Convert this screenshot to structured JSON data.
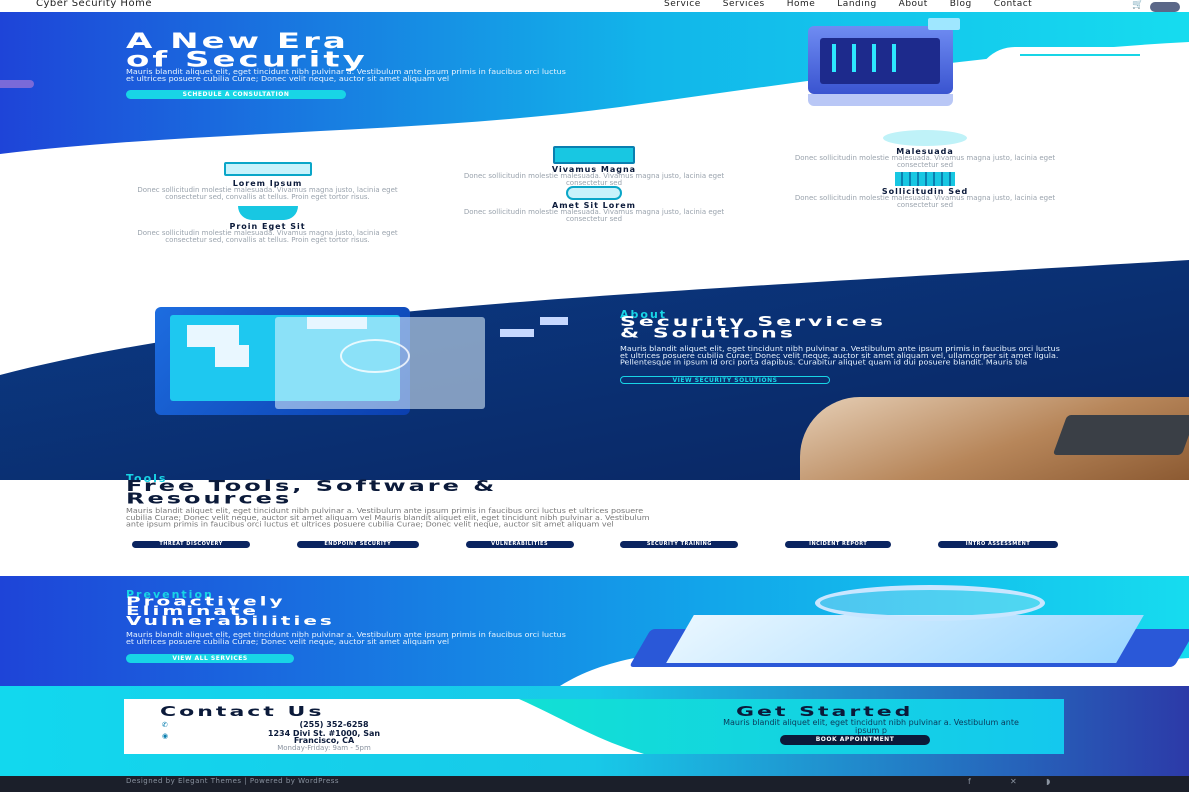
{
  "header": {
    "site_title": "Cyber Security Home",
    "nav": [
      "Service",
      "Services",
      "Home",
      "Landing",
      "About",
      "Blog",
      "Contact"
    ]
  },
  "hero": {
    "title_line1": "A New Era",
    "title_line2": "of Security",
    "body": "Mauris blandit aliquet elit, eget tincidunt nibh pulvinar a. Vestibulum ante ipsum primis in faucibus orci luctus et ultrices posuere cubilia Curae; Donec velit neque, auctor sit amet aliquam vel",
    "cta": "SCHEDULE A CONSULTATION"
  },
  "services": [
    {
      "title": "Lorem Ipsum",
      "body": "Donec sollicitudin molestie malesuada. Vivamus magna justo, lacinia eget consectetur sed, convallis at tellus. Proin eget tortor risus."
    },
    {
      "title": "Proin Eget Sit",
      "body": "Donec sollicitudin molestie malesuada. Vivamus magna justo, lacinia eget consectetur sed, convallis at tellus. Proin eget tortor risus."
    },
    {
      "title": "Vivamus Magna",
      "body": "Donec sollicitudin molestie malesuada. Vivamus magna justo, lacinia eget consectetur sed"
    },
    {
      "title": "Amet Sit Lorem",
      "body": "Donec sollicitudin molestie malesuada. Vivamus magna justo, lacinia eget consectetur sed"
    },
    {
      "title": "Malesuada",
      "body": "Donec sollicitudin molestie malesuada. Vivamus magna justo, lacinia eget consectetur sed"
    },
    {
      "title": "Sollicitudin Sed",
      "body": "Donec sollicitudin molestie malesuada. Vivamus magna justo, lacinia eget consectetur sed"
    }
  ],
  "about": {
    "eyebrow": "About",
    "title_line1": "Security Services",
    "title_line2": "& Solutions",
    "body": "Mauris blandit aliquet elit, eget tincidunt nibh pulvinar a. Vestibulum ante ipsum primis in faucibus orci luctus et ultrices posuere cubilia Curae; Donec velit neque, auctor sit amet aliquam vel, ullamcorper sit amet ligula. Pellentesque in ipsum id orci porta dapibus. Curabitur aliquet quam id dui posuere blandit. Mauris bla",
    "cta": "VIEW SECURITY SOLUTIONS"
  },
  "tools": {
    "eyebrow": "Tools",
    "title_line1": "Free Tools, Software &",
    "title_line2": "Resources",
    "body": "Mauris blandit aliquet elit, eget tincidunt nibh pulvinar a. Vestibulum ante ipsum primis in faucibus orci luctus et ultrices posuere cubilia Curae; Donec velit neque, auctor sit amet aliquam vel Mauris blandit aliquet elit, eget tincidunt nibh pulvinar a. Vestibulum ante ipsum primis in faucibus orci luctus et ultrices posuere cubilia Curae; Donec velit neque, auctor sit amet aliquam vel",
    "buttons": [
      "THREAT DISCOVERY",
      "ENDPOINT SECURITY",
      "VULNERABILITIES",
      "SECURITY TRAINING",
      "INCIDENT REPORT",
      "INTRO ASSESSMENT"
    ]
  },
  "prevention": {
    "eyebrow": "Prevention",
    "title_line1": "Proactively",
    "title_line2": "Eliminate",
    "title_line3": "Vulnerabilities",
    "body": "Mauris blandit aliquet elit, eget tincidunt nibh pulvinar a. Vestibulum ante ipsum primis in faucibus orci luctus et ultrices posuere cubilia Curae; Donec velit neque, auctor sit amet aliquam vel",
    "cta": "VIEW ALL SERVICES"
  },
  "contact": {
    "title": "Contact Us",
    "phone": "(255) 352-6258",
    "address_line1": "1234 Divi St. #1000, San",
    "address_line2": "Francisco, CA",
    "hours": "Monday-Friday: 9am - 5pm"
  },
  "get_started": {
    "title": "Get Started",
    "body": "Mauris blandit aliquet elit, eget tincidunt nibh pulvinar a. Vestibulum ante ipsum p",
    "cta": "BOOK APPOINTMENT"
  },
  "footer": {
    "credit": "Designed by Elegant Themes | Powered by WordPress"
  },
  "colors": {
    "navy": "#0a2a6b",
    "deep_blue": "#1e3fd6",
    "cyan": "#14d8e6",
    "teal": "#1de3c9",
    "dark": "#0b1a3a"
  }
}
